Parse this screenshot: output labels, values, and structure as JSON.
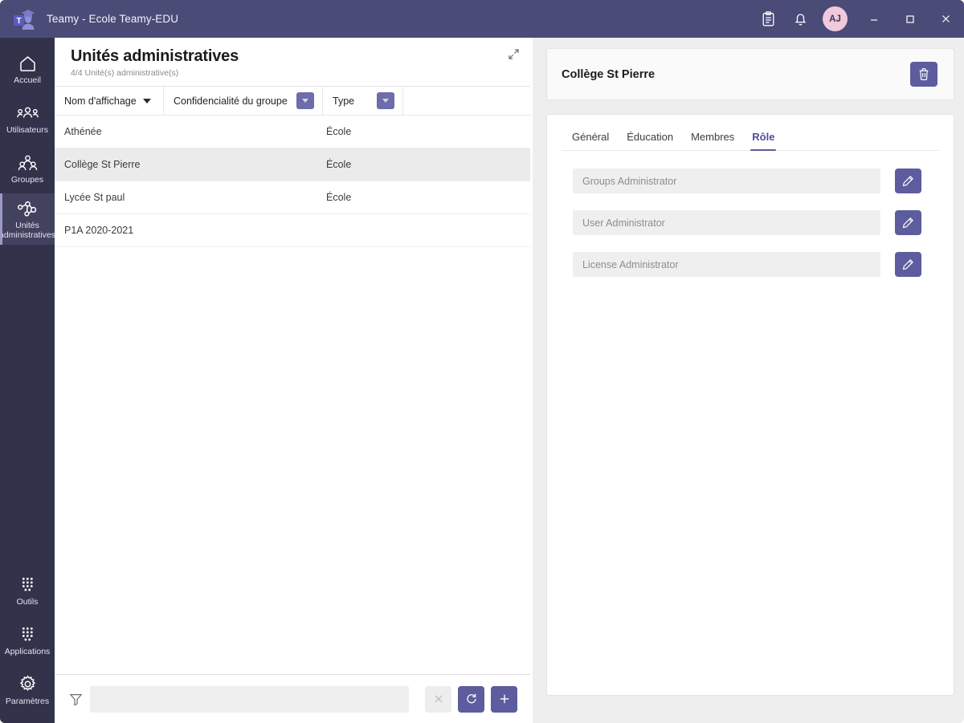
{
  "window": {
    "app_title": "Teamy - Ecole Teamy-EDU",
    "logo_icon": "teamy-graduate-logo",
    "clipboard_icon": "clipboard-icon",
    "bell_icon": "bell-notification-icon",
    "avatar_initials": "AJ",
    "minimize_icon": "minimize-icon",
    "maximize_icon": "maximize-icon",
    "close_icon": "close-icon",
    "accent": "#4b4b78",
    "avatar_bg": "#f0c9dc"
  },
  "sidebar": {
    "bg": "#32324b",
    "active_bg": "#42425f",
    "top_items": [
      {
        "label": "Accueil",
        "icon": "home-icon",
        "active": false
      },
      {
        "label": "Utilisateurs",
        "icon": "users-icon",
        "active": false
      },
      {
        "label": "Groupes",
        "icon": "groups-icon",
        "active": false
      },
      {
        "label": "Unités\nadministratives",
        "label_line1": "Unités",
        "label_line2": "administratives",
        "icon": "org-units-icon",
        "active": true
      }
    ],
    "bottom_items": [
      {
        "label": "Outils",
        "icon": "tools-grid-icon"
      },
      {
        "label": "Applications",
        "icon": "applications-grid-icon"
      },
      {
        "label": "Paramètres",
        "icon": "gear-settings-icon"
      }
    ]
  },
  "list_panel": {
    "title": "Unités administratives",
    "subtitle": "4/4 Unité(s) administrative(s)",
    "expand_icon": "expand-diagonal-icon",
    "columns": [
      {
        "label": "Nom d'affichage",
        "sorted": true,
        "has_dropdown": false
      },
      {
        "label": "Confidencialité du groupe",
        "sorted": false,
        "has_dropdown": true
      },
      {
        "label": "Type",
        "sorted": false,
        "has_dropdown": true
      },
      {
        "label": "",
        "sorted": false,
        "has_dropdown": false
      }
    ],
    "rows": [
      {
        "name": "Athénée",
        "confidentiality": "",
        "type": "École",
        "selected": false
      },
      {
        "name": "Collège St Pierre",
        "confidentiality": "",
        "type": "École",
        "selected": true
      },
      {
        "name": "Lycée St paul",
        "confidentiality": "",
        "type": "École",
        "selected": false
      },
      {
        "name": "P1A 2020-2021",
        "confidentiality": "",
        "type": "",
        "selected": false
      }
    ],
    "footer": {
      "filter_icon": "funnel-filter-icon",
      "filter_value": "",
      "filter_placeholder": "",
      "clear_icon": "clear-x-icon",
      "refresh_icon": "refresh-icon",
      "add_icon": "plus-add-icon"
    }
  },
  "detail_panel": {
    "title": "Collège St Pierre",
    "delete_icon": "trash-delete-icon",
    "tabs": [
      {
        "label": "Général",
        "active": false
      },
      {
        "label": "Éducation",
        "active": false
      },
      {
        "label": "Membres",
        "active": false
      },
      {
        "label": "Rôle",
        "active": true
      }
    ],
    "roles": [
      {
        "value": "",
        "placeholder": "Groups Administrator",
        "edit_icon": "pencil-edit-icon"
      },
      {
        "value": "",
        "placeholder": "User Administrator",
        "edit_icon": "pencil-edit-icon"
      },
      {
        "value": "",
        "placeholder": "License Administrator",
        "edit_icon": "pencil-edit-icon"
      }
    ]
  }
}
